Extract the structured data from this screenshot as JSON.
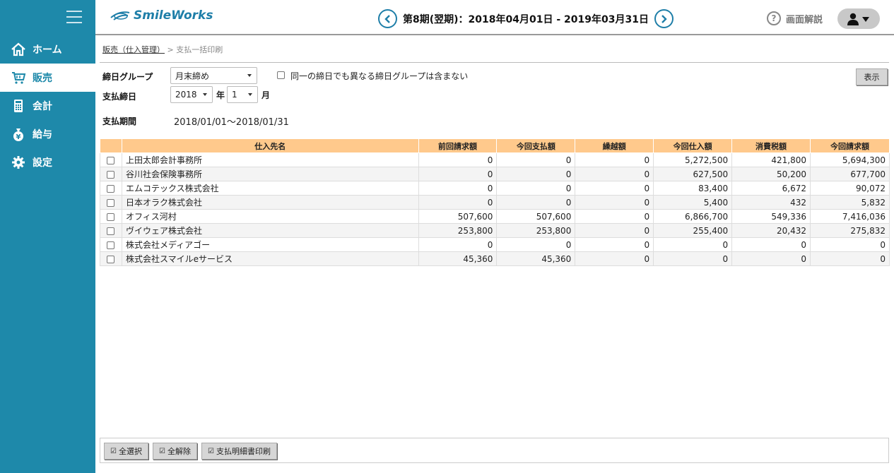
{
  "sidebar": {
    "items": [
      {
        "label": "ホーム",
        "icon": "home-icon",
        "active": false
      },
      {
        "label": "販売",
        "icon": "cart-icon",
        "active": true
      },
      {
        "label": "会計",
        "icon": "calculator-icon",
        "active": false
      },
      {
        "label": "給与",
        "icon": "money-bag-icon",
        "active": false
      },
      {
        "label": "設定",
        "icon": "gear-icon",
        "active": false
      }
    ]
  },
  "header": {
    "logo_text": "SmileWorks",
    "period": "第8期(翌期)：2018年04月01日 - 2019年03月31日",
    "help_label": "画面解説"
  },
  "breadcrumb": {
    "link": "販売（仕入管理）",
    "separator": " > ",
    "current": "支払一括印刷"
  },
  "form": {
    "group_label": "締日グループ",
    "group_value": "月末締め",
    "exclude_label": "同一の締日でも異なる締日グループは含まない",
    "pay_close_label": "支払締日",
    "year_value": "2018",
    "year_unit": "年",
    "month_value": "1",
    "month_unit": "月",
    "period_label": "支払期間",
    "period_value": "2018/01/01〜2018/01/31",
    "show_button": "表示"
  },
  "table": {
    "headers": [
      "仕入先名",
      "前回請求額",
      "今回支払額",
      "繰越額",
      "今回仕入額",
      "消費税額",
      "今回請求額"
    ],
    "rows": [
      [
        "上田太郎会計事務所",
        "0",
        "0",
        "0",
        "5,272,500",
        "421,800",
        "5,694,300"
      ],
      [
        "谷川社会保険事務所",
        "0",
        "0",
        "0",
        "627,500",
        "50,200",
        "677,700"
      ],
      [
        "エムコテックス株式会社",
        "0",
        "0",
        "0",
        "83,400",
        "6,672",
        "90,072"
      ],
      [
        "日本オラク株式会社",
        "0",
        "0",
        "0",
        "5,400",
        "432",
        "5,832"
      ],
      [
        "オフィス河村",
        "507,600",
        "507,600",
        "0",
        "6,866,700",
        "549,336",
        "7,416,036"
      ],
      [
        "ヴイウェア株式会社",
        "253,800",
        "253,800",
        "0",
        "255,400",
        "20,432",
        "275,832"
      ],
      [
        "株式会社メディアゴー",
        "0",
        "0",
        "0",
        "0",
        "0",
        "0"
      ],
      [
        "株式会社スマイルeサービス",
        "45,360",
        "45,360",
        "0",
        "0",
        "0",
        "0"
      ]
    ]
  },
  "footer": {
    "select_all": "全選択",
    "deselect_all": "全解除",
    "print": "支払明細書印刷"
  },
  "colors": {
    "sidebar": "#1e89aa",
    "table_header": "#ffc98c",
    "accent": "#1e7ea8"
  }
}
